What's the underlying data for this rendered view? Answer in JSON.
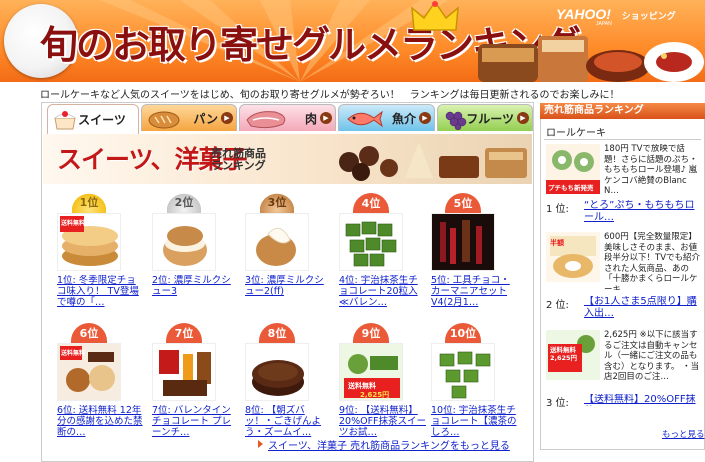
{
  "header": {
    "title": "旬のお取り寄せグルメランキング",
    "yahoo_logo": "YAHOO!",
    "yahoo_japan": "JAPAN",
    "service": "ショッピング"
  },
  "intro": "ロールケーキなど人気のスイーツをはじめ、旬のお取り寄せグルメが勢ぞろい！　ランキングは毎日更新されるのでお楽しみに！",
  "tabs": [
    {
      "label": "スイーツ",
      "icon": "cake-icon",
      "active": true,
      "color": "#ffffff"
    },
    {
      "label": "パン",
      "icon": "bread-icon",
      "active": false,
      "color": "#f5a440"
    },
    {
      "label": "肉",
      "icon": "meat-icon",
      "active": false,
      "color": "#f4a8b8"
    },
    {
      "label": "魚介",
      "icon": "fish-icon",
      "active": false,
      "color": "#6ec3ea"
    },
    {
      "label": "フルーツ",
      "icon": "grapes-icon",
      "active": false,
      "color": "#94cf52"
    }
  ],
  "banner": {
    "title": "スイーツ、洋菓子",
    "subtitle_line1": "売れ筋商品",
    "subtitle_line2": "ランキング"
  },
  "ranks": [
    {
      "badge": "1位",
      "style": "gold",
      "caption": "1位: 冬季限定チョコ味入り！ TV登場で噂の「…"
    },
    {
      "badge": "2位",
      "style": "silver",
      "caption": "2位: 濃厚ミルクシュー3"
    },
    {
      "badge": "3位",
      "style": "bronze",
      "caption": "3位: 濃厚ミルクシュー2(ff)"
    },
    {
      "badge": "4位",
      "style": "red",
      "caption": "4位: 宇治抹茶生チョコレート20粒入≪バレン…"
    },
    {
      "badge": "5位",
      "style": "red",
      "caption": "5位: 工具チョコ・カーマニアセットV4(2月1…"
    },
    {
      "badge": "6位",
      "style": "red",
      "caption": "6位: 送料無料 12年分の感謝を込めた禁断の…"
    },
    {
      "badge": "7位",
      "style": "red",
      "caption": "7位: バレンタインチョコレート プレーンチ…"
    },
    {
      "badge": "8位",
      "style": "red",
      "caption": "8位: 【朝ズバッ！・ごきげんよう・ズームイ…"
    },
    {
      "badge": "9位",
      "style": "red",
      "caption": "9位: 【送料無料】20%OFF抹茶スイーツお試…"
    },
    {
      "badge": "10位",
      "style": "red",
      "caption": "10位: 宇治抹茶生チョコレート【濃茶のしろ…"
    }
  ],
  "thumb_labels": {
    "free_shipping": "送料無料",
    "price_2625": "2,625円"
  },
  "more_link": "スイーツ、洋菓子 売れ筋商品ランキングをもっと見る",
  "sidebar": {
    "title": "売れ筋商品ランキング",
    "category": "ロールケーキ",
    "items": [
      {
        "rank": "1 位:",
        "desc": "180円 TVで放映で話題！さらに話題のぷち・もちもちロール登場♪ 嵐ケンコバ絶賛のBlanc N…",
        "link": "“とろ”ぷち・もちもちロール…",
        "badge": "プチもち新発売"
      },
      {
        "rank": "2 位:",
        "desc": "600円【完全数量限定】美味しさそのまま、お値段半分以下！TVでも紹介された人気商品、あの「十勝かまくらロールケーキ…",
        "link": "【お1人さま5点限り】購入出…",
        "badge": "半額"
      },
      {
        "rank": "3 位:",
        "desc": "2,625円 ※以下に該当するご注文は自動キャンセル（一緒にご注文の品も含む）となります。 ・当店2回目のご注…",
        "link": "【送料無料】20%OFF抹茶…",
        "badge": "送料無料 2,625円"
      }
    ],
    "more": "もっと見る"
  }
}
